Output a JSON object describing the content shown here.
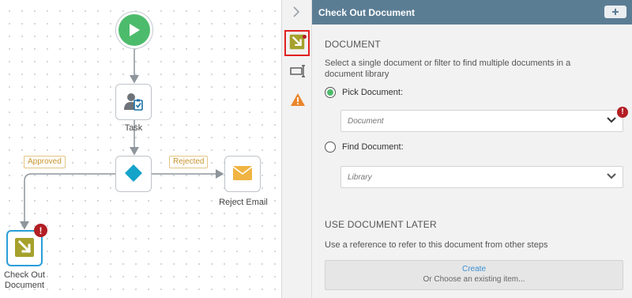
{
  "canvas": {
    "nodes": {
      "start": {
        "icon": "play-icon"
      },
      "task": {
        "label": "Task",
        "icon": "user-task-icon"
      },
      "decision": {
        "icon": "diamond-icon"
      },
      "reject_email": {
        "label": "Reject Email",
        "icon": "envelope-icon"
      },
      "checkout": {
        "label_line1": "Check Out",
        "label_line2": "Document",
        "icon": "checkout-icon"
      }
    },
    "tags": {
      "approved": "Approved",
      "rejected": "Rejected"
    },
    "error_mark": "!"
  },
  "panel": {
    "rail": {
      "collapse_icon": "chevron-right-icon",
      "items": [
        "checkout-icon",
        "text-cursor-icon",
        "warning-icon"
      ]
    },
    "header": {
      "title": "Check Out Document",
      "action_icon": "plus-icon"
    },
    "document": {
      "title": "DOCUMENT",
      "description": "Select a single document or filter to find multiple documents in a document library",
      "pick_label": "Pick Document:",
      "pick_placeholder": "Document",
      "find_label": "Find Document:",
      "find_placeholder": "Library",
      "selected": "pick"
    },
    "later": {
      "title": "USE DOCUMENT LATER",
      "description": "Use a reference to refer to this document from other steps",
      "create_label": "Create",
      "choose_label": "Or Choose an existing item..."
    }
  },
  "colors": {
    "header_bg": "#5b7d94",
    "accent_green": "#4dbb6c",
    "error_red": "#b21e23",
    "decision_teal": "#15a3c9",
    "tag_orange": "#c8952f",
    "checkout_olive": "#a5a12c"
  }
}
